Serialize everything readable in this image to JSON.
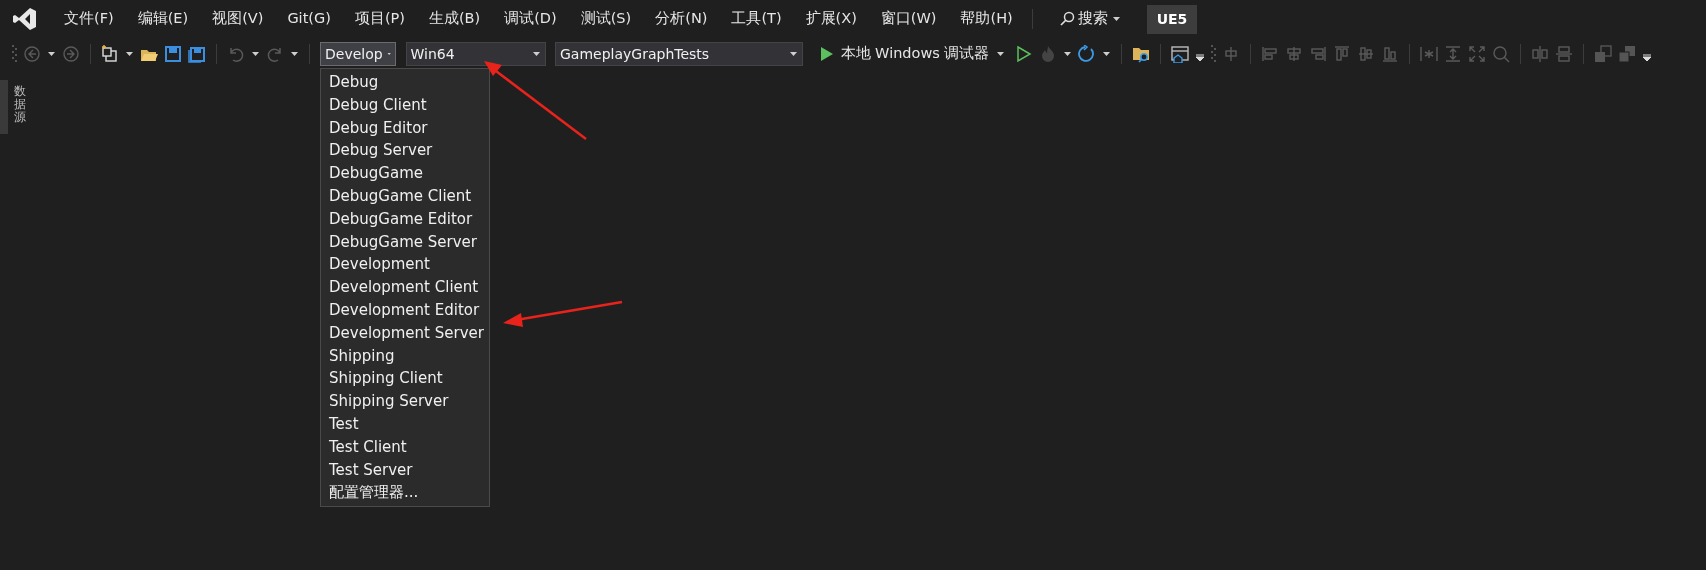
{
  "menu_bar": {
    "items": [
      "文件(F)",
      "编辑(E)",
      "视图(V)",
      "Git(G)",
      "项目(P)",
      "生成(B)",
      "调试(D)",
      "测试(S)",
      "分析(N)",
      "工具(T)",
      "扩展(X)",
      "窗口(W)",
      "帮助(H)"
    ],
    "search": "搜索",
    "badge": "UE5"
  },
  "toolbar": {
    "configuration": "Develop",
    "platform": "Win64",
    "project": "GameplayGraphTests",
    "debugger": "本地 Windows 调试器"
  },
  "configuration_menu": {
    "expanded": true,
    "items": [
      {
        "label": "Debug"
      },
      {
        "label": "Debug Client"
      },
      {
        "label": "Debug Editor"
      },
      {
        "label": "Debug Server"
      },
      {
        "label": "DebugGame"
      },
      {
        "label": "DebugGame Client"
      },
      {
        "label": "DebugGame Editor"
      },
      {
        "label": "DebugGame Server"
      },
      {
        "label": "Development"
      },
      {
        "label": "Development Client"
      },
      {
        "label": "Development Editor"
      },
      {
        "label": "Development Server"
      },
      {
        "label": "Shipping"
      },
      {
        "label": "Shipping Client"
      },
      {
        "label": "Shipping Server"
      },
      {
        "label": "Test"
      },
      {
        "label": "Test Client"
      },
      {
        "label": "Test Server"
      },
      {
        "label": "配置管理器..."
      }
    ]
  },
  "side_tab": "数据源"
}
